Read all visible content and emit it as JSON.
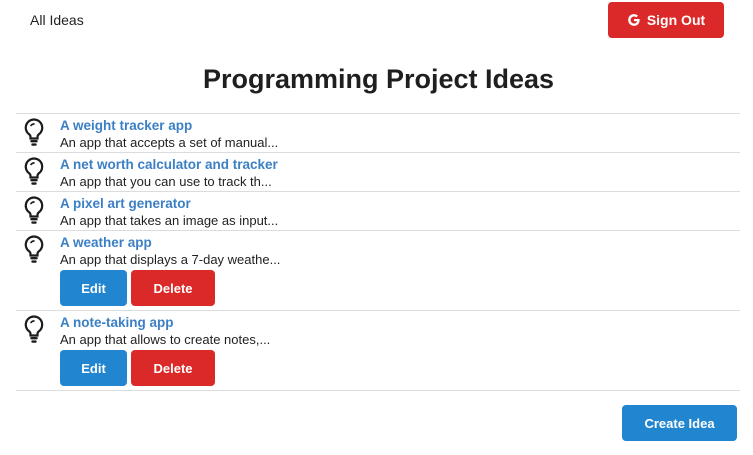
{
  "nav": {
    "all_ideas_label": "All Ideas",
    "sign_out_label": "Sign Out",
    "sign_out_icon": "google-icon"
  },
  "page": {
    "title": "Programming Project Ideas"
  },
  "ideas": [
    {
      "title": "A weight tracker app",
      "description": "An app that accepts a set of manual...",
      "icon": "lightbulb-icon"
    },
    {
      "title": "A net worth calculator and tracker",
      "description": "An app that you can use to track th...",
      "icon": "lightbulb-icon"
    },
    {
      "title": "A pixel art generator",
      "description": "An app that takes an image as input...",
      "icon": "lightbulb-icon"
    },
    {
      "title": "A weather app",
      "description": "An app that displays a 7-day weathe...",
      "icon": "lightbulb-icon",
      "edit_label": "Edit",
      "delete_label": "Delete"
    },
    {
      "title": "A note-taking app",
      "description": "An app that allows to create notes,...",
      "icon": "lightbulb-icon",
      "edit_label": "Edit",
      "delete_label": "Delete"
    }
  ],
  "actions": {
    "create_label": "Create Idea"
  },
  "colors": {
    "primary": "#2185d0",
    "danger": "#db2828",
    "link": "#3b7fc4"
  }
}
